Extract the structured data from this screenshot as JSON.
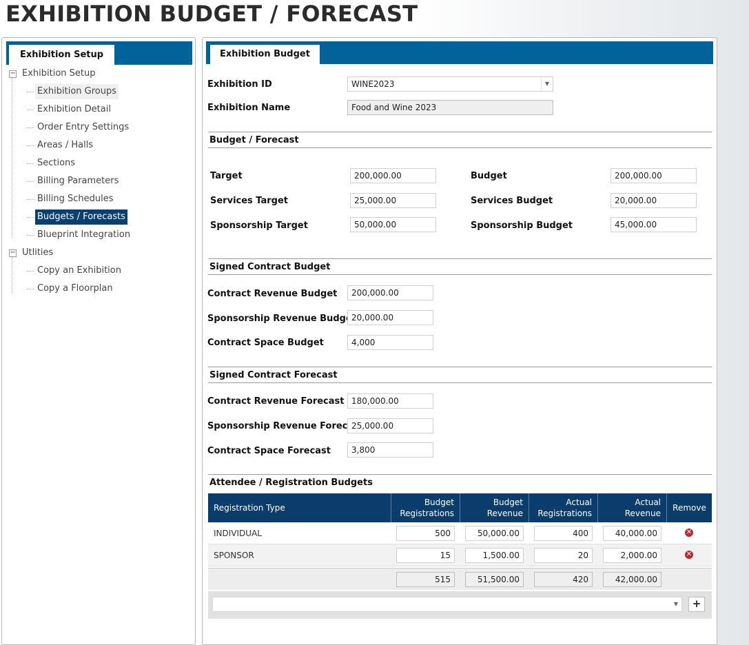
{
  "page": {
    "title": "EXHIBITION BUDGET / FORECAST"
  },
  "nav": {
    "tab_label": "Exhibition Setup",
    "groups": [
      {
        "label": "Exhibition Setup",
        "expander": "−",
        "items": [
          "Exhibition Groups",
          "Exhibition Detail",
          "Order Entry Settings",
          "Areas / Halls",
          "Sections",
          "Billing Parameters",
          "Billing Schedules",
          "Budgets / Forecasts",
          "Blueprint Integration"
        ]
      },
      {
        "label": "Utlities",
        "expander": "−",
        "items": [
          "Copy an Exhibition",
          "Copy a Floorplan"
        ]
      }
    ],
    "selected_item": "Budgets / Forecasts",
    "hover_item": "Exhibition Groups"
  },
  "main": {
    "tab_label": "Exhibition Budget",
    "exhibition_id": {
      "label": "Exhibition ID",
      "value": "WINE2023"
    },
    "exhibition_name": {
      "label": "Exhibition Name",
      "value": "Food and Wine 2023"
    },
    "budget_forecast": {
      "header": "Budget / Forecast",
      "target": {
        "label": "Target",
        "value": "200,000.00"
      },
      "budget": {
        "label": "Budget",
        "value": "200,000.00"
      },
      "services_target": {
        "label": "Services Target",
        "value": "25,000.00"
      },
      "services_budget": {
        "label": "Services Budget",
        "value": "20,000.00"
      },
      "sponsorship_target": {
        "label": "Sponsorship Target",
        "value": "50,000.00"
      },
      "sponsorship_budget": {
        "label": "Sponsorship Budget",
        "value": "45,000.00"
      }
    },
    "signed_contract_budget": {
      "header": "Signed Contract Budget",
      "contract_revenue": {
        "label": "Contract Revenue Budget",
        "value": "200,000.00"
      },
      "sponsorship_revenue": {
        "label": "Sponsorship Revenue Budget",
        "value": "20,000.00"
      },
      "contract_space": {
        "label": "Contract Space Budget",
        "value": "4,000"
      }
    },
    "signed_contract_forecast": {
      "header": "Signed Contract Forecast",
      "contract_revenue": {
        "label": "Contract Revenue Forecast",
        "value": "180,000.00"
      },
      "sponsorship_revenue": {
        "label": "Sponsorship Revenue Forecast",
        "value": "25,000.00"
      },
      "contract_space": {
        "label": "Contract Space Forecast",
        "value": "3,800"
      }
    },
    "registration": {
      "header": "Attendee / Registration Budgets",
      "columns": {
        "type": "Registration Type",
        "budget_regs": "Budget Registrations",
        "budget_rev": "Budget Revenue",
        "actual_regs": "Actual Registrations",
        "actual_rev": "Actual Revenue",
        "remove": "Remove"
      },
      "rows": [
        {
          "type": "INDIVIDUAL",
          "budget_regs": "500",
          "budget_rev": "50,000.00",
          "actual_regs": "400",
          "actual_rev": "40,000.00"
        },
        {
          "type": "SPONSOR",
          "budget_regs": "15",
          "budget_rev": "1,500.00",
          "actual_regs": "20",
          "actual_rev": "2,000.00"
        }
      ],
      "totals": {
        "budget_regs": "515",
        "budget_rev": "51,500.00",
        "actual_regs": "420",
        "actual_rev": "42,000.00"
      },
      "add_button": "+"
    }
  },
  "icons": {
    "remove": "remove-circle-icon",
    "dropdown": "chevron-down-icon"
  },
  "colors": {
    "tab_strip": "#00639a",
    "grid_header": "#0a3d6b",
    "selected": "#0a4070",
    "remove": "#c0282b"
  }
}
